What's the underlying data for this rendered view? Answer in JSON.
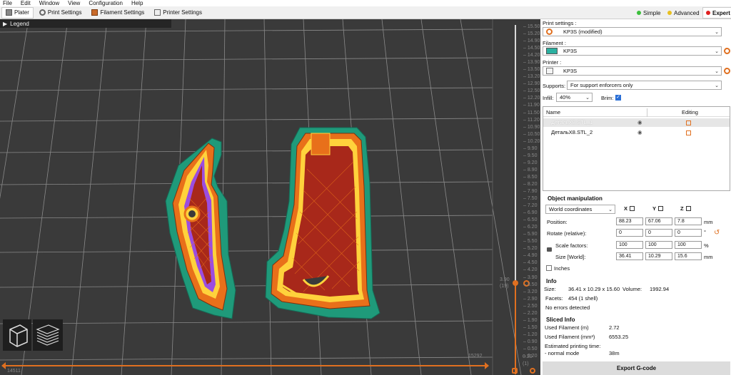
{
  "menu": [
    "File",
    "Edit",
    "Window",
    "View",
    "Configuration",
    "Help"
  ],
  "tabs": [
    {
      "label": "Plater",
      "active": true
    },
    {
      "label": "Print Settings",
      "active": false
    },
    {
      "label": "Filament Settings",
      "active": false
    },
    {
      "label": "Printer Settings",
      "active": false
    }
  ],
  "modes": {
    "simple": "Simple",
    "advanced": "Advanced",
    "expert": "Expert"
  },
  "viewport": {
    "legend_label": "Legend",
    "h_min": "14511",
    "h_max": "15292"
  },
  "vslider": {
    "ticks": [
      "15.50",
      "15.20",
      "14.90",
      "14.50",
      "14.20",
      "13.90",
      "13.50",
      "13.20",
      "12.90",
      "12.50",
      "12.20",
      "11.90",
      "11.50",
      "11.20",
      "10.90",
      "10.50",
      "10.20",
      "9.90",
      "9.50",
      "9.20",
      "8.90",
      "8.50",
      "8.20",
      "7.90",
      "7.50",
      "7.20",
      "6.90",
      "6.50",
      "6.20",
      "5.90",
      "5.50",
      "5.20",
      "4.90",
      "4.50",
      "4.20",
      "3.90",
      "3.50",
      "3.20",
      "2.90",
      "2.50",
      "2.20",
      "1.90",
      "1.50",
      "1.20",
      "0.90",
      "0.50",
      "0.20"
    ],
    "upper_value": "3.90",
    "upper_layer": "(19)",
    "lower_value": "0.20",
    "lower_layer": "(1)"
  },
  "panel": {
    "print_settings_label": "Print settings :",
    "print_settings_value": "KP3S (modified)",
    "filament_label": "Filament :",
    "filament_value": "KP3S",
    "filament_color": "#2ab0a0",
    "printer_label": "Printer :",
    "printer_value": "KP3S",
    "supports_label": "Supports:",
    "supports_value": "For support enforcers only",
    "infill_label": "Infill:",
    "infill_value": "40%",
    "brim_label": "Brim:",
    "list_header_name": "Name",
    "list_header_editing": "Editing",
    "objects": [
      {
        "name": "ДетальX8.STL_1",
        "selected": true
      },
      {
        "name": "ДетальX8.STL_2",
        "selected": false
      }
    ]
  },
  "object_manipulation": {
    "title": "Object manipulation",
    "coords": "World coordinates",
    "axis_x": "X",
    "axis_y": "Y",
    "axis_z": "Z",
    "position_label": "Position:",
    "position": [
      "88.23",
      "67.06",
      "7.8"
    ],
    "position_unit": "mm",
    "rotate_label": "Rotate (relative):",
    "rotate": [
      "0",
      "0",
      "0"
    ],
    "rotate_unit": "°",
    "scale_label": "Scale factors:",
    "scale": [
      "100",
      "100",
      "100"
    ],
    "scale_unit": "%",
    "size_label": "Size [World]:",
    "size": [
      "36.41",
      "10.29",
      "15.6"
    ],
    "size_unit": "mm",
    "inches_label": "Inches"
  },
  "info": {
    "title": "Info",
    "size_label": "Size:",
    "size_value": "36.41 x 10.29 x 15.60",
    "volume_label": "Volume:",
    "volume_value": "1992.94",
    "facets_label": "Facets:",
    "facets_value": "454 (1 shell)",
    "errors": "No errors detected"
  },
  "sliced": {
    "title": "Sliced Info",
    "used_m_label": "Used Filament (m)",
    "used_m_value": "2.72",
    "used_mm3_label": "Used Filament (mm³)",
    "used_mm3_value": "6553.25",
    "time_label": "Estimated printing time:",
    "normal_label": "- normal mode",
    "normal_value": "38m"
  },
  "export_label": "Export G-code",
  "colors": {
    "brim": "#1f9a7a",
    "perimeter": "#e8701a",
    "inner": "#ffd23c",
    "infill": "#a8281a",
    "solid": "#9b4de0",
    "accent": "#e07020"
  }
}
